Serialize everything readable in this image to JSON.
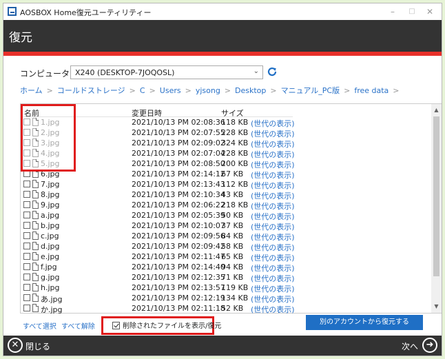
{
  "window": {
    "title": "AOSBOX Home復元ユーティリティー",
    "minimize": "–",
    "maximize": "□",
    "close": "✕"
  },
  "header": {
    "title": "復元"
  },
  "computer": {
    "label": "コンピューター名:",
    "selected": "X240 (DESKTOP-7JOQOSL)",
    "dropdown": "⌄"
  },
  "breadcrumb": [
    "ホーム",
    "コールドストレージ",
    "C",
    "Users",
    "yjsong",
    "Desktop",
    "マニュアル_PC版",
    "free data"
  ],
  "breadcrumb_sep": ">",
  "columns": {
    "name": "名前",
    "date": "変更日時",
    "size": "サイズ"
  },
  "scroll": {
    "up": "▲",
    "down": "▼"
  },
  "files": [
    {
      "name": "1.jpg",
      "date": "2021/10/13 PM 02:08:36",
      "size": "118 KB",
      "history": "(世代の表示)",
      "deleted": true
    },
    {
      "name": "2.jpg",
      "date": "2021/10/13 PM 02:07:55",
      "size": "228 KB",
      "history": "(世代の表示)",
      "deleted": true
    },
    {
      "name": "3.jpg",
      "date": "2021/10/13 PM 02:09:02",
      "size": "324 KB",
      "history": "(世代の表示)",
      "deleted": true
    },
    {
      "name": "4.jpg",
      "date": "2021/10/13 PM 02:07:04",
      "size": "228 KB",
      "history": "(世代の表示)",
      "deleted": true
    },
    {
      "name": "5.jpg",
      "date": "2021/10/13 PM 02:08:50",
      "size": "200 KB",
      "history": "(世代の表示)",
      "deleted": true
    },
    {
      "name": "6.jpg",
      "date": "2021/10/13 PM 02:14:12",
      "size": "67 KB",
      "history": "(世代の表示)",
      "deleted": false
    },
    {
      "name": "7.jpg",
      "date": "2021/10/13 PM 02:13:43",
      "size": "112 KB",
      "history": "(世代の表示)",
      "deleted": false
    },
    {
      "name": "8.jpg",
      "date": "2021/10/13 PM 02:10:34",
      "size": "43 KB",
      "history": "(世代の表示)",
      "deleted": false
    },
    {
      "name": "9.jpg",
      "date": "2021/10/13 PM 02:06:22",
      "size": "218 KB",
      "history": "(世代の表示)",
      "deleted": false
    },
    {
      "name": "a.jpg",
      "date": "2021/10/13 PM 02:05:39",
      "size": "50 KB",
      "history": "(世代の表示)",
      "deleted": false
    },
    {
      "name": "b.jpg",
      "date": "2021/10/13 PM 02:10:07",
      "size": "37 KB",
      "history": "(世代の表示)",
      "deleted": false
    },
    {
      "name": "c.jpg",
      "date": "2021/10/13 PM 02:09:56",
      "size": "84 KB",
      "history": "(世代の表示)",
      "deleted": false
    },
    {
      "name": "d.jpg",
      "date": "2021/10/13 PM 02:09:42",
      "size": "58 KB",
      "history": "(世代の表示)",
      "deleted": false
    },
    {
      "name": "e.jpg",
      "date": "2021/10/13 PM 02:11:47",
      "size": "65 KB",
      "history": "(世代の表示)",
      "deleted": false
    },
    {
      "name": "f.jpg",
      "date": "2021/10/13 PM 02:14:40",
      "size": "94 KB",
      "history": "(世代の表示)",
      "deleted": false
    },
    {
      "name": "g.jpg",
      "date": "2021/10/13 PM 02:12:35",
      "size": "71 KB",
      "history": "(世代の表示)",
      "deleted": false
    },
    {
      "name": " h.jpg",
      "date": "2021/10/13 PM 02:13:57",
      "size": "119 KB",
      "history": "(世代の表示)",
      "deleted": false
    },
    {
      "name": "あ.jpg",
      "date": "2021/10/13 PM 02:12:19",
      "size": "134 KB",
      "history": "(世代の表示)",
      "deleted": false
    },
    {
      "name": "か.jpg",
      "date": "2021/10/13 PM 02:11:18",
      "size": "52 KB",
      "history": "(世代の表示)",
      "deleted": false
    }
  ],
  "actions": {
    "select_all": "すべて選択",
    "deselect_all": "すべて解除",
    "show_deleted": "削除されたファイルを表示/復元",
    "show_deleted_checked": true,
    "other_account": "別のアカウントから復元する"
  },
  "footer": {
    "close_icon": "✕",
    "close": "閉じる",
    "next": "次へ",
    "next_icon": "➜"
  },
  "colors": {
    "accent_blue": "#1f6fc5",
    "link_blue": "#2a72c8",
    "header_dark": "#333333",
    "red_line": "#e8302a",
    "highlight_red": "#e01b1b",
    "outer_bg": "#e6f3d6"
  }
}
